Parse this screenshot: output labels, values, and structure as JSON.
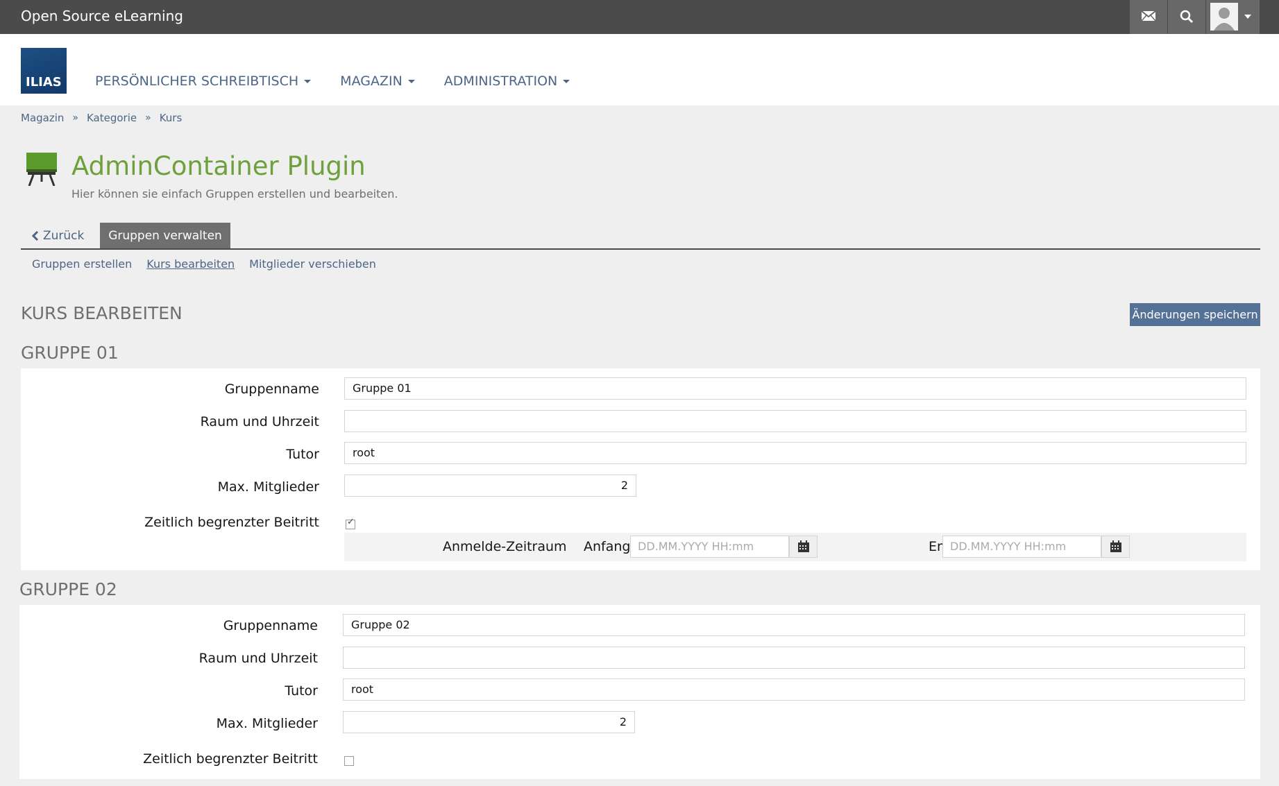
{
  "topbar": {
    "brand": "Open Source eLearning"
  },
  "logo": {
    "text": "ILIAS"
  },
  "mainmenu": [
    {
      "label": "PERSÖNLICHER SCHREIBTISCH"
    },
    {
      "label": "MAGAZIN"
    },
    {
      "label": "ADMINISTRATION"
    }
  ],
  "breadcrumb": [
    "Magazin",
    "Kategorie",
    "Kurs"
  ],
  "breadcrumb_sep": "»",
  "page": {
    "title": "AdminContainer Plugin",
    "description": "Hier können sie einfach Gruppen erstellen und bearbeiten."
  },
  "tabs": {
    "back": "Zurück",
    "active": "Gruppen verwalten"
  },
  "subtabs": [
    "Gruppen erstellen",
    "Kurs bearbeiten",
    "Mitglieder verschieben"
  ],
  "section": {
    "title": "KURS BEARBEITEN",
    "save": "Änderungen speichern"
  },
  "labels": {
    "groupname": "Gruppenname",
    "room": "Raum und Uhrzeit",
    "tutor": "Tutor",
    "max": "Max. Mitglieder",
    "limited": "Zeitlich begrenzter Beitritt",
    "period": "Anmelde-Zeitraum",
    "start": "Anfang",
    "end": "Ende",
    "date_placeholder": "DD.MM.YYYY HH:mm"
  },
  "groups": [
    {
      "head": "GRUPPE 01",
      "name": "Gruppe 01",
      "room": "",
      "tutor": "root",
      "max": "2",
      "limited": true
    },
    {
      "head": "GRUPPE 02",
      "name": "Gruppe 02",
      "room": "",
      "tutor": "root",
      "max": "2",
      "limited": false
    }
  ]
}
